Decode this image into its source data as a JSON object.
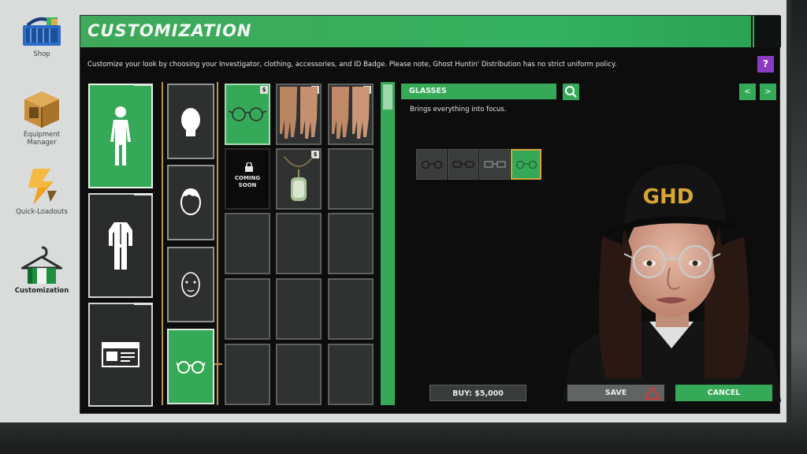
{
  "nav": {
    "items": [
      {
        "label": "Shop",
        "icon": "shop-basket-icon"
      },
      {
        "label": "Equipment\nManager",
        "icon": "crate-icon"
      },
      {
        "label": "Quick-Loadouts",
        "icon": "lightning-icon"
      },
      {
        "label": "Customization",
        "icon": "hanger-icon",
        "active": true
      }
    ]
  },
  "header": {
    "title": "CUSTOMIZATION",
    "description": "Customize your look by choosing your Investigator, clothing, accessories, and ID Badge. Please note, Ghost Huntin' Distribution has no strict uniform policy.",
    "help_label": "?"
  },
  "categories": [
    {
      "name": "investigator",
      "icon": "body-icon",
      "active": true
    },
    {
      "name": "clothing",
      "icon": "outfit-icon"
    },
    {
      "name": "id-badge",
      "icon": "id-card-icon"
    }
  ],
  "subcategories": [
    {
      "name": "head",
      "icon": "head-icon"
    },
    {
      "name": "hair",
      "icon": "hair-icon"
    },
    {
      "name": "face",
      "icon": "face-icon"
    },
    {
      "name": "glasses",
      "icon": "glasses-icon",
      "active": true
    }
  ],
  "grid": {
    "items": [
      {
        "icon": "glasses-icon",
        "selected": true,
        "price_tag": "$"
      },
      {
        "icon": "hands-icon",
        "price_tag": "$"
      },
      {
        "icon": "hands-icon",
        "price_tag": "$"
      },
      {
        "icon": "lock-icon",
        "coming_soon": "COMING\nSOON",
        "price_tag": ""
      },
      {
        "icon": "dog-tag-icon",
        "price_tag": "$"
      }
    ]
  },
  "detail": {
    "title": "GLASSES",
    "description": "Brings everything into focus.",
    "prev_label": "<",
    "next_label": ">",
    "variant_count": 4,
    "selected_variant": 4
  },
  "avatar": {
    "cap_text": "GHD"
  },
  "buttons": {
    "buy": "BUY: $5,000",
    "save": "SAVE",
    "cancel": "CANCEL"
  },
  "colors": {
    "accent": "#35a957",
    "help": "#8a3bc4",
    "gold": "#b99446"
  }
}
